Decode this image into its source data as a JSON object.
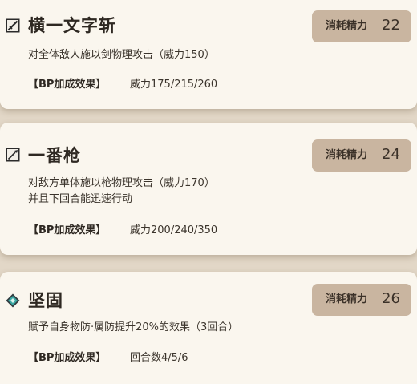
{
  "skills": [
    {
      "icon": "sword-slash-icon",
      "name": "横一文字斩",
      "cost_label": "消耗精力",
      "cost_value": "22",
      "description": [
        "对全体敌人施以剑物理攻击（威力150）"
      ],
      "bp_label": "【BP加成效果】",
      "bp_value": "威力175/215/260"
    },
    {
      "icon": "spear-icon",
      "name": "一番枪",
      "cost_label": "消耗精力",
      "cost_value": "24",
      "description": [
        "对敌方单体施以枪物理攻击（威力170）",
        "并且下回合能迅速行动"
      ],
      "bp_label": "【BP加成效果】",
      "bp_value": "威力200/240/350"
    },
    {
      "icon": "buff-diamond-icon",
      "name": "坚固",
      "cost_label": "消耗精力",
      "cost_value": "26",
      "description": [
        "赋予自身物防·属防提升20%的效果（3回合）"
      ],
      "bp_label": "【BP加成效果】",
      "bp_value": "回合数4/5/6"
    }
  ],
  "colors": {
    "card_bg": "#faf6ee",
    "page_bg": "#e2d7c7",
    "badge_bg": "#c9b5a0",
    "text": "#3b342c",
    "buff_icon": "#3aa7a2"
  }
}
